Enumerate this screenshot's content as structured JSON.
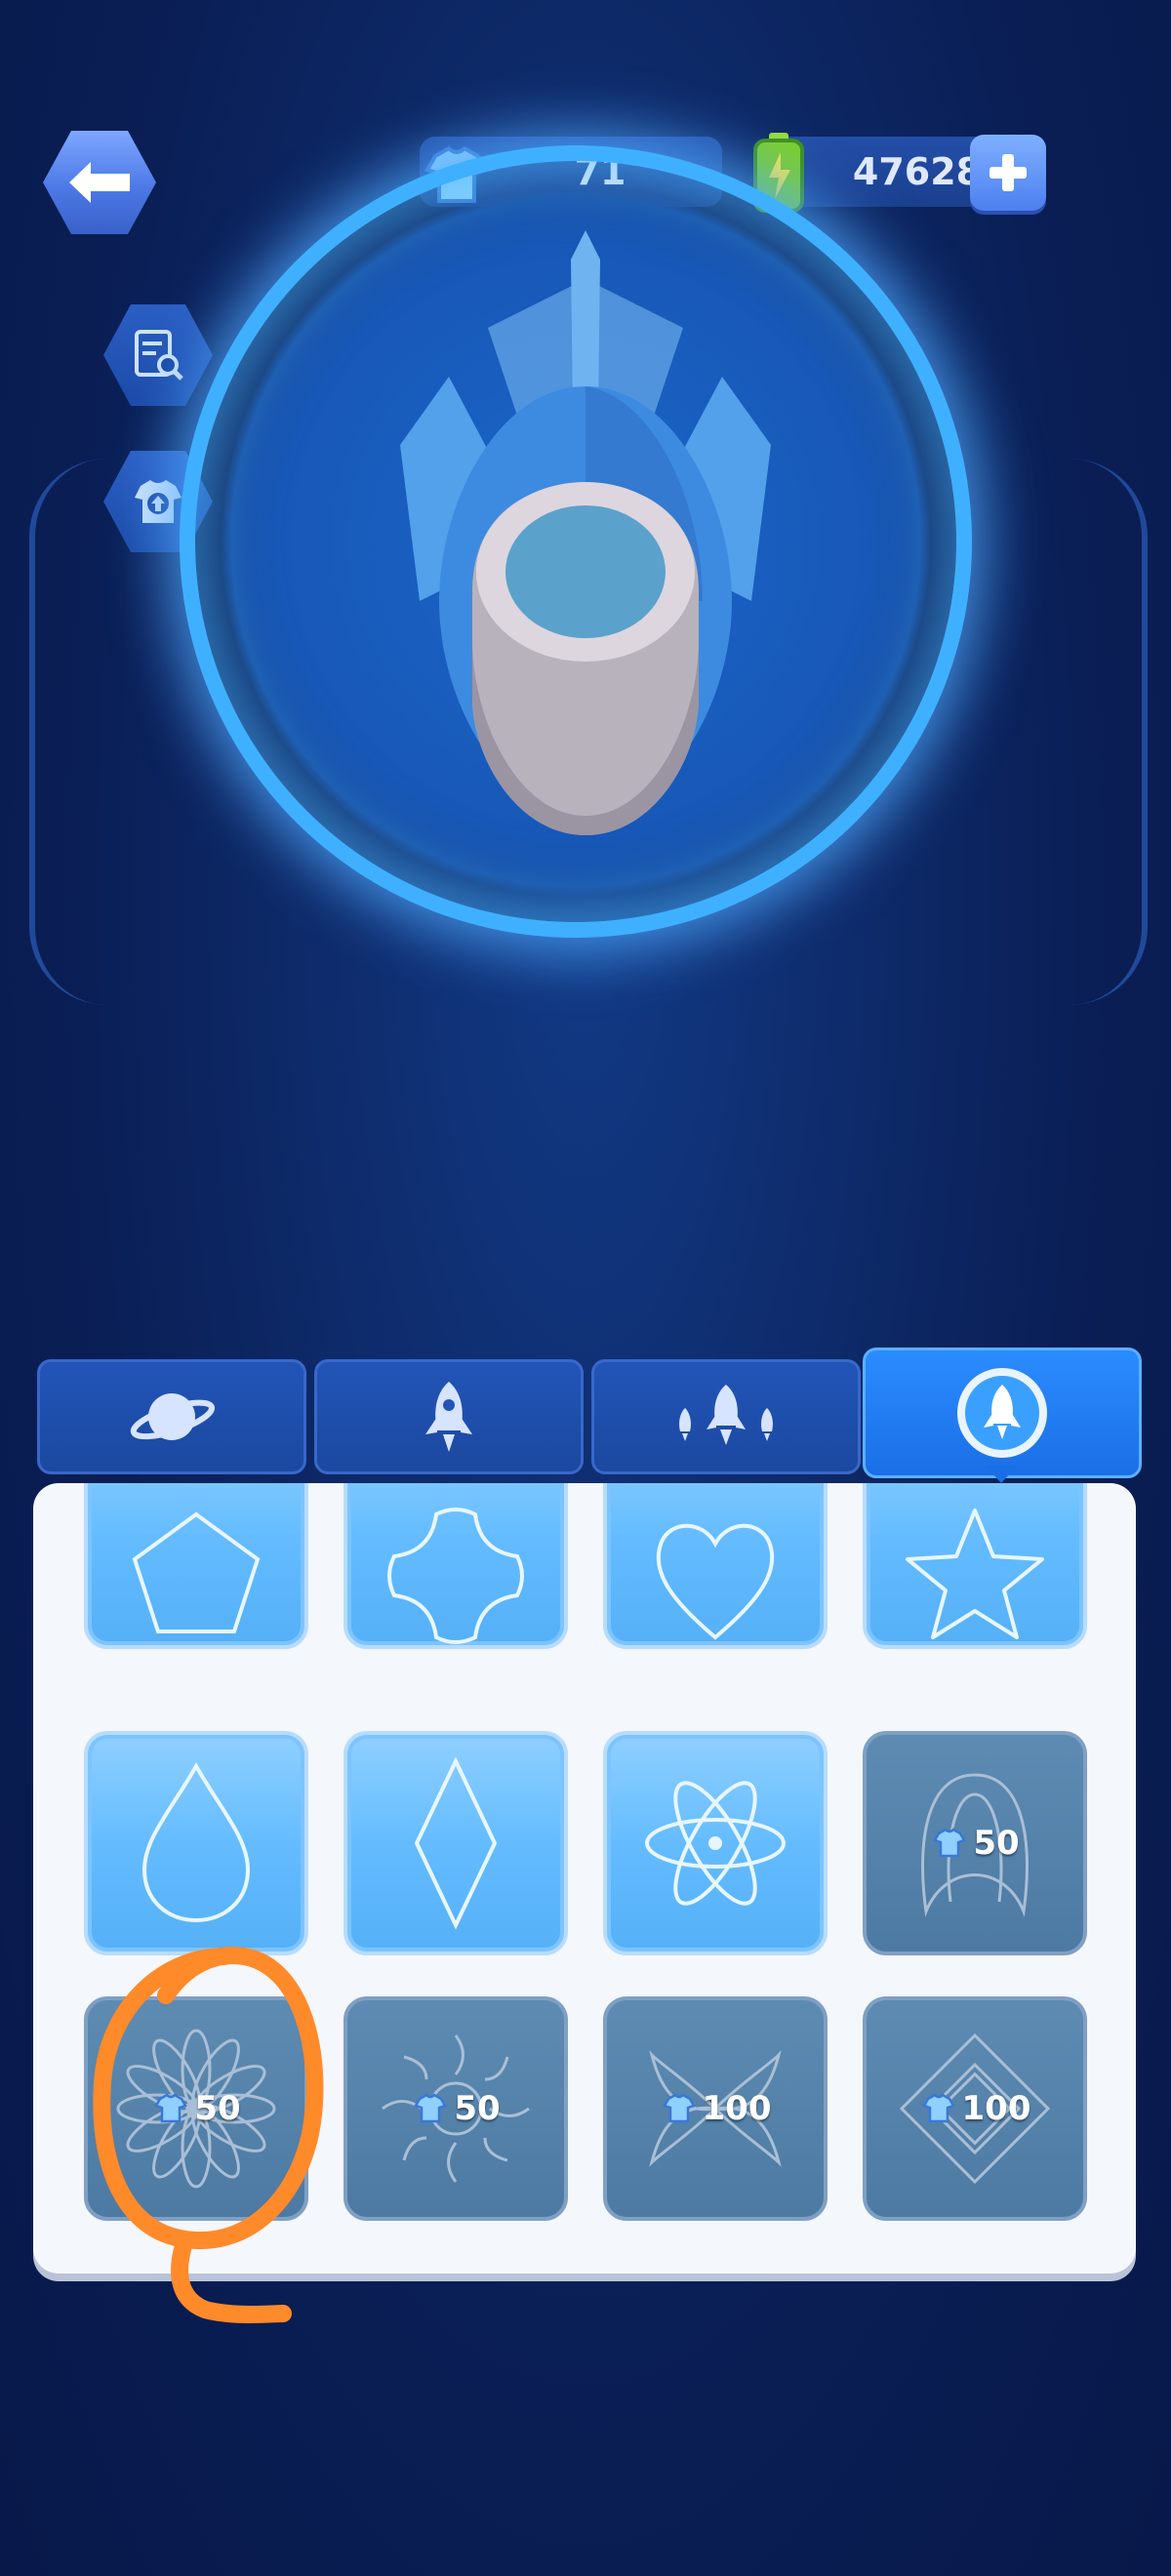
{
  "header": {
    "skin_count": "71",
    "energy": "47628"
  },
  "icons": {
    "back": "back-arrow-icon",
    "inspect": "document-search-icon",
    "upgrade": "shirt-upload-icon",
    "skin": "shirt-currency-icon",
    "energy": "battery-icon",
    "add": "plus-icon"
  },
  "tabs": [
    {
      "id": "planet",
      "icon": "planet-icon"
    },
    {
      "id": "rocket",
      "icon": "rocket-icon"
    },
    {
      "id": "fleet",
      "icon": "fleet-icon"
    },
    {
      "id": "badge",
      "icon": "rocket-badge-icon",
      "active": true
    }
  ],
  "shop": {
    "prices": [
      "50",
      "50",
      "50",
      "100",
      "100"
    ]
  },
  "colors": {
    "accent": "#3fb0ff",
    "panel": "#f4f7fc",
    "owned_tile": "#64bcff",
    "locked_tile": "#4d7aa2",
    "annotation": "#ff8a2a"
  }
}
